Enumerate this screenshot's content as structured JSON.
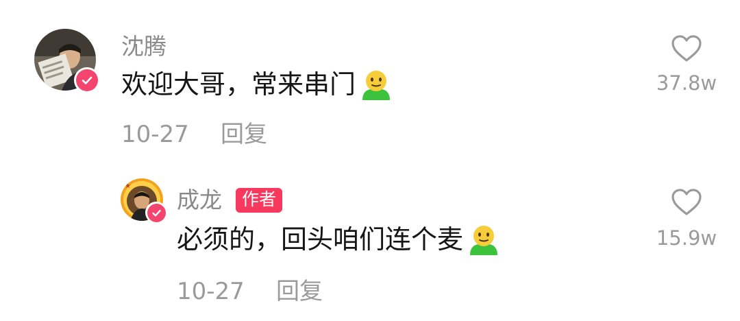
{
  "comments": [
    {
      "username": "沈腾",
      "text": "欢迎大哥，常来串门",
      "date": "10-27",
      "reply_label": "回复",
      "likes": "37.8w",
      "emoji": "smile-emoji",
      "verified": true
    },
    {
      "username": "成龙",
      "author_badge": "作者",
      "text": "必须的，回头咱们连个麦",
      "date": "10-27",
      "reply_label": "回复",
      "likes": "15.9w",
      "emoji": "smile-emoji",
      "verified": true
    }
  ],
  "colors": {
    "verified": "#f3456e",
    "author_badge": "#f8385d",
    "meta_text": "#9a9a9a",
    "name_text": "#8a8a8a",
    "body_text": "#161616"
  }
}
